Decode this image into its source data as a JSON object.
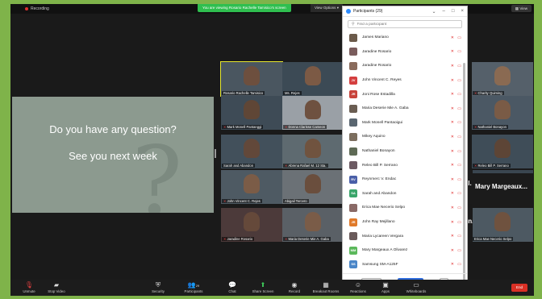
{
  "topbar": {
    "recording_label": "Recording",
    "share_banner": "You are viewing Rosario Rachelle Tamisico's screen",
    "view_options": "View Options",
    "view": "View"
  },
  "share": {
    "line1": "Do you have any question?",
    "line2": "See you next week",
    "watermark": "?"
  },
  "tiles": [
    {
      "name": "Rosario Rachelle Tamisico",
      "muted": false
    },
    {
      "name": "Ms. Rejes",
      "muted": false
    },
    {
      "name": "",
      "muted": false
    },
    {
      "name": "Charity Quiming",
      "muted": true
    },
    {
      "name": "Mark Monell Pantanggi",
      "muted": true
    },
    {
      "name": "Donna Clarisse Cameon",
      "muted": true
    },
    {
      "name": "Nathaniel Bonayon",
      "muted": true
    },
    {
      "name": "Sarah and Abandon",
      "muted": false
    },
    {
      "name": "Abrena Rafael M. 12 Sta.",
      "muted": true
    },
    {
      "name": "Releo Bill P. Serrano",
      "muted": true
    },
    {
      "name": "John Vincent C. Rejes",
      "muted": true
    },
    {
      "name": "Abigail Tercero",
      "muted": false
    },
    {
      "name": "Mary Margeaux A Olivarez",
      "muted": false
    },
    {
      "name": "Jaradine Rosario",
      "muted": true
    },
    {
      "name": "Maria Deserie Mie A. Gaba",
      "muted": true
    },
    {
      "name": "Erica Mae Necerio Selpo",
      "muted": false
    }
  ],
  "black_tiles": [
    {
      "big": "Il...",
      "name": ""
    },
    {
      "big": "Mary  Margeaux...",
      "name": "Mary Margeaux A Olivarez"
    },
    {
      "big": "in...",
      "name": ""
    },
    {
      "big": "",
      "name": "Erica Mae Necerio Selpo"
    }
  ],
  "participants_panel": {
    "title": "Participants (29)",
    "search_placeholder": "Find a participant",
    "invite_label": "Invite",
    "mute_all_label": "Mute All",
    "more_label": "...",
    "items": [
      {
        "name": "James Mariano",
        "initials": "",
        "color": "#6b5a4a"
      },
      {
        "name": "Jaradine Rosario",
        "initials": "",
        "color": "#7a5c5c"
      },
      {
        "name": "Jaradine Rosario",
        "initials": "",
        "color": "#8a6b5c"
      },
      {
        "name": "John Vincent C. Reyes",
        "initials": "JV",
        "color": "#d43f3f"
      },
      {
        "name": "Joni Rose Estadilla",
        "initials": "JR",
        "color": "#c8433a"
      },
      {
        "name": "Maria Deserie Mie A. Gaba",
        "initials": "",
        "color": "#6a5d52"
      },
      {
        "name": "Mark Monell Pantaoigui",
        "initials": "",
        "color": "#5a6670"
      },
      {
        "name": "Mikey Aquino",
        "initials": "",
        "color": "#7c6e5e"
      },
      {
        "name": "Nathaniel Bonayon",
        "initials": "",
        "color": "#5e6a55"
      },
      {
        "name": "Releo Bill P. Serrano",
        "initials": "",
        "color": "#6c5a62"
      },
      {
        "name": "Reynmerc V. Endac",
        "initials": "RV",
        "color": "#4a5fa8"
      },
      {
        "name": "Sarah and Abandon",
        "initials": "SA",
        "color": "#3aa56a"
      },
      {
        "name": "Erica Mae Necerio Selpo",
        "initials": "",
        "color": "#8a6a66"
      },
      {
        "name": "John Ray Mejillano",
        "initials": "JR",
        "color": "#e07a2a"
      },
      {
        "name": "Maria Lycareen Vergara",
        "initials": "",
        "color": "#6a5a5a"
      },
      {
        "name": "Mary Margeaux A Olivarez",
        "initials": "MM",
        "color": "#5bb85b"
      },
      {
        "name": "Samsung SM-A125F",
        "initials": "SS",
        "color": "#4a86c8"
      }
    ]
  },
  "toolbar": {
    "unmute": "Unmute",
    "stop_video": "Stop Video",
    "security": "Security",
    "participants": "Participants",
    "participants_count": "29",
    "chat": "Chat",
    "share_screen": "Share Screen",
    "record": "Record",
    "breakout_rooms": "Breakout Rooms",
    "reactions": "Reactions",
    "apps": "Apps",
    "whiteboards": "Whiteboards",
    "end": "End"
  }
}
